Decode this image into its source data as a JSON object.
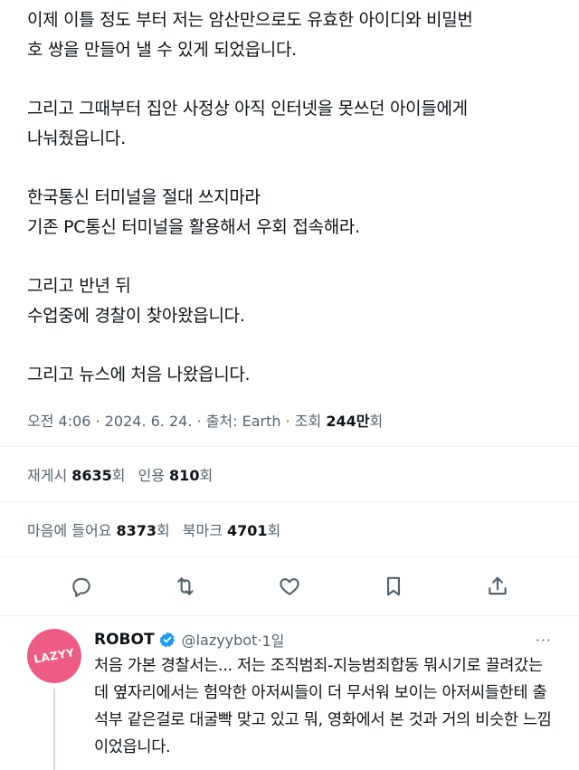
{
  "tweet": {
    "paragraphs": [
      "이제 이틀 정도 부터 저는 암산만으로도 유효한 아이디와 비밀번\n호 쌍을 만들어 낼 수 있게 되었읍니다.",
      "그리고 그때부터 집안 사정상 아직 인터넷을 못쓰던 아이들에게\n나눠줬읍니다.",
      "한국통신 터미널을 절대 쓰지마라\n기존 PC통신 터미널을 활용해서 우회 접속해라.",
      "그리고 반년 뒤\n수업중에 경찰이 찾아왔읍니다.",
      "그리고 뉴스에 처음 나왔읍니다."
    ],
    "meta": {
      "time": "오전 4:06",
      "sep1": " · ",
      "date": "2024. 6. 24.",
      "sep2": " · ",
      "source": "출처: Earth",
      "sep3": " · ",
      "views_label": "조회 ",
      "views_value": "244만",
      "views_suffix": "회"
    },
    "stats_row1": [
      {
        "label": "재게시 ",
        "value": "8635",
        "suffix": "회"
      },
      {
        "label": "인용 ",
        "value": "810",
        "suffix": "회"
      }
    ],
    "stats_row2": [
      {
        "label": "마음에 들어요 ",
        "value": "8373",
        "suffix": "회"
      },
      {
        "label": "북마크 ",
        "value": "4701",
        "suffix": "회"
      }
    ],
    "actions": [
      "reply-icon",
      "retweet-icon",
      "like-icon",
      "bookmark-icon",
      "share-icon"
    ]
  },
  "reply": {
    "avatar_text": "LAZYY",
    "avatar_color": "#ee5c86",
    "name": "ROBOT",
    "handle": "@lazyybot",
    "sep": "·",
    "age": "1일",
    "more": "···",
    "text": "처음 가본 경찰서는... 저는 조직범죄-지능범죄합동 뭐시기로 끌려갔는데 옆자리에서는 험악한 아저씨들이 더 무서워 보이는 아저씨들한테 출석부 같은걸로 대굴빡 맞고 있고 뭐, 영화에서 본 것과 거의 비슷한 느낌이었읍니다."
  },
  "colors": {
    "text": "#0f1419",
    "secondary": "#536471",
    "verified_blue": "#1d9bf0",
    "divider": "#eff3f4"
  }
}
